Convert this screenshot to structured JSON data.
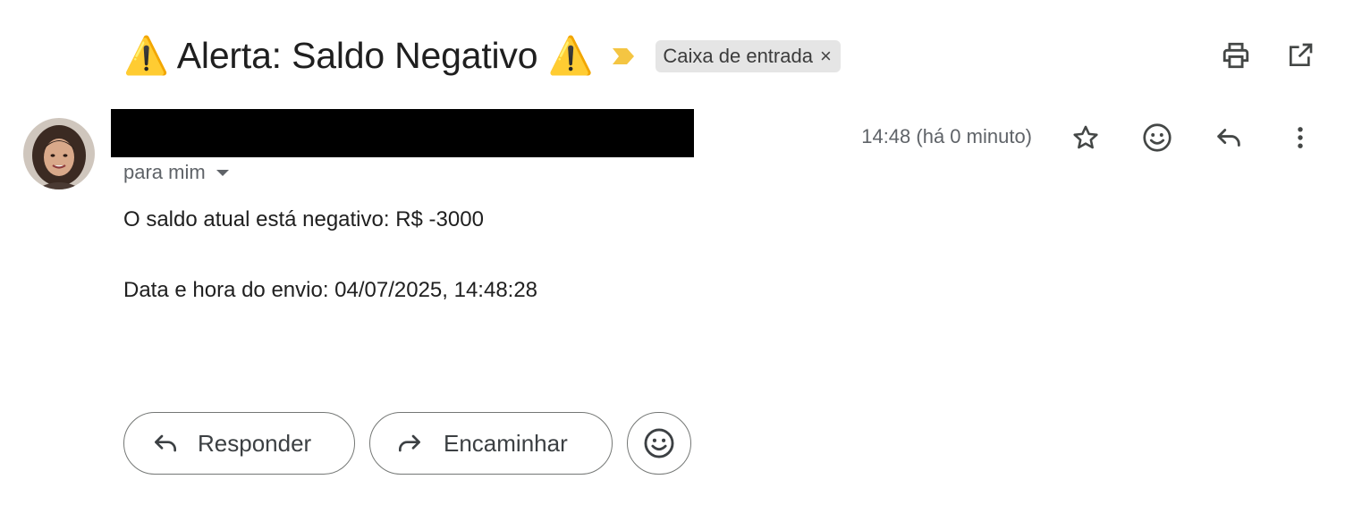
{
  "subject": {
    "title": "⚠️ Alerta: Saldo Negativo ⚠️",
    "label_chip": "Caixa de entrada",
    "label_remove": "×"
  },
  "toolbar": {
    "icons": [
      "print-icon",
      "open-in-new-window-icon"
    ]
  },
  "message": {
    "recipient": "para mim",
    "timestamp": "14:48 (há 0 minuto)",
    "header_icons": [
      "star-icon",
      "emoji-reaction-icon",
      "reply-icon",
      "more-vert-icon"
    ],
    "body": {
      "line1": "O saldo atual está negativo: R$ -3000",
      "line2": "Data e hora do envio: 04/07/2025, 14:48:28"
    }
  },
  "actions": {
    "reply_label": "Responder",
    "forward_label": "Encaminhar"
  },
  "colors": {
    "importance_marker": "#f4c542",
    "chip_background": "#e5e5e5",
    "secondary_text": "#5f6368",
    "button_border": "#747775"
  }
}
